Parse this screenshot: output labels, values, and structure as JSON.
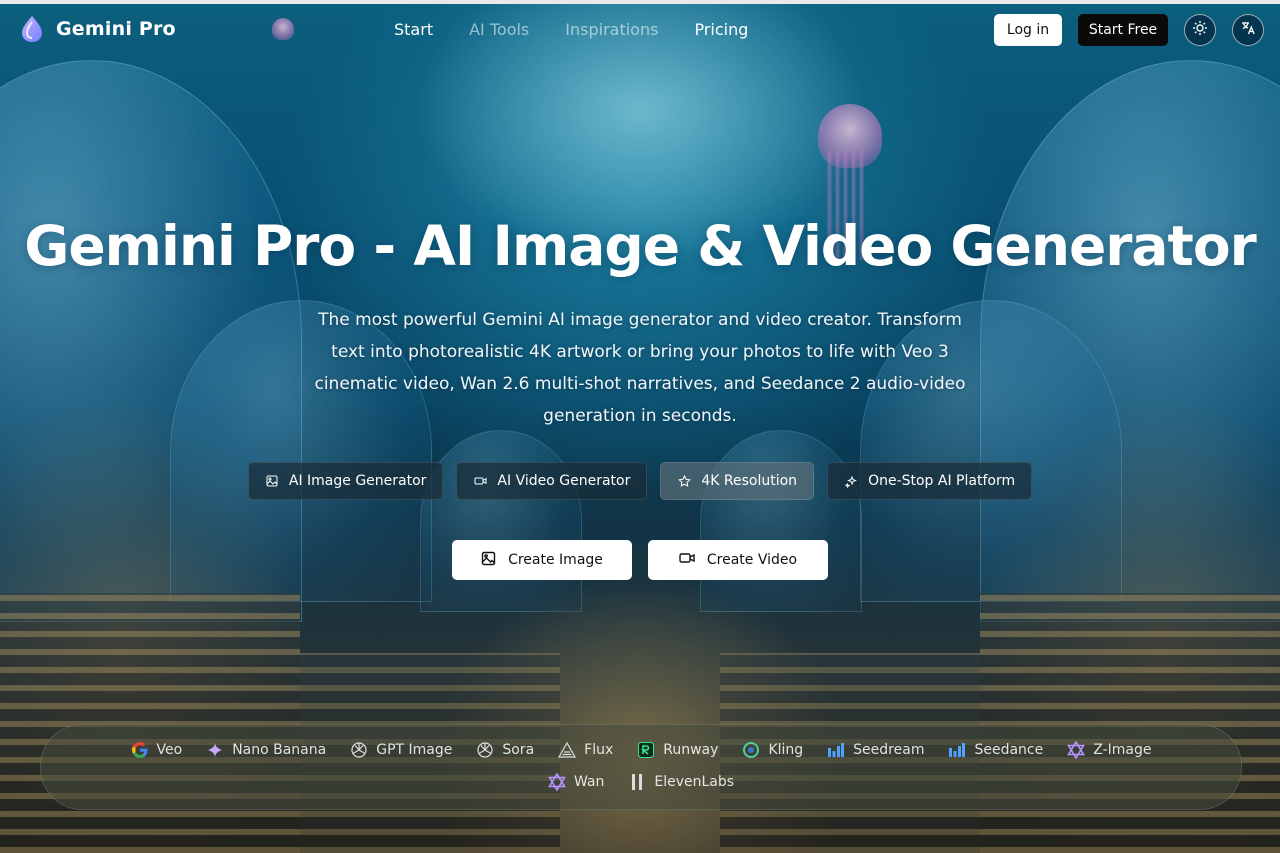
{
  "brand": {
    "name": "Gemini Pro"
  },
  "nav": {
    "items": [
      {
        "label": "Start"
      },
      {
        "label": "AI Tools"
      },
      {
        "label": "Inspirations"
      },
      {
        "label": "Pricing"
      }
    ]
  },
  "header": {
    "login_label": "Log in",
    "start_free_label": "Start Free",
    "theme_icon": "sun-icon",
    "language_icon": "translate-icon"
  },
  "hero": {
    "title": "Gemini Pro - AI Image & Video Generator",
    "description": "The most powerful Gemini AI image generator and video creator. Transform text into photorealistic 4K artwork or bring your photos to life with Veo 3 cinematic video, Wan 2.6 multi-shot narratives, and Seedance 2 audio-video generation in seconds."
  },
  "features": [
    {
      "label": "AI Image Generator",
      "icon": "image-icon"
    },
    {
      "label": "AI Video Generator",
      "icon": "video-camera-icon"
    },
    {
      "label": "4K Resolution",
      "icon": "star-icon"
    },
    {
      "label": "One-Stop AI Platform",
      "icon": "sparkles-icon"
    }
  ],
  "cta": {
    "create_image": "Create Image",
    "create_video": "Create Video"
  },
  "models": [
    {
      "label": "Veo",
      "icon": "google-icon"
    },
    {
      "label": "Nano Banana",
      "icon": "sparkle-icon"
    },
    {
      "label": "GPT Image",
      "icon": "openai-icon"
    },
    {
      "label": "Sora",
      "icon": "openai-icon"
    },
    {
      "label": "Flux",
      "icon": "flux-icon"
    },
    {
      "label": "Runway",
      "icon": "runway-icon"
    },
    {
      "label": "Kling",
      "icon": "kling-icon"
    },
    {
      "label": "Seedream",
      "icon": "bar-chart-icon"
    },
    {
      "label": "Seedance",
      "icon": "bar-chart-icon"
    },
    {
      "label": "Z-Image",
      "icon": "star-of-david-icon"
    },
    {
      "label": "Wan",
      "icon": "star-of-david-icon"
    },
    {
      "label": "ElevenLabs",
      "icon": "pause-bars-icon"
    }
  ],
  "colors": {
    "accent_white": "#ffffff",
    "button_dark": "#0a0a0a",
    "chip_bg": "#1e2f38"
  }
}
